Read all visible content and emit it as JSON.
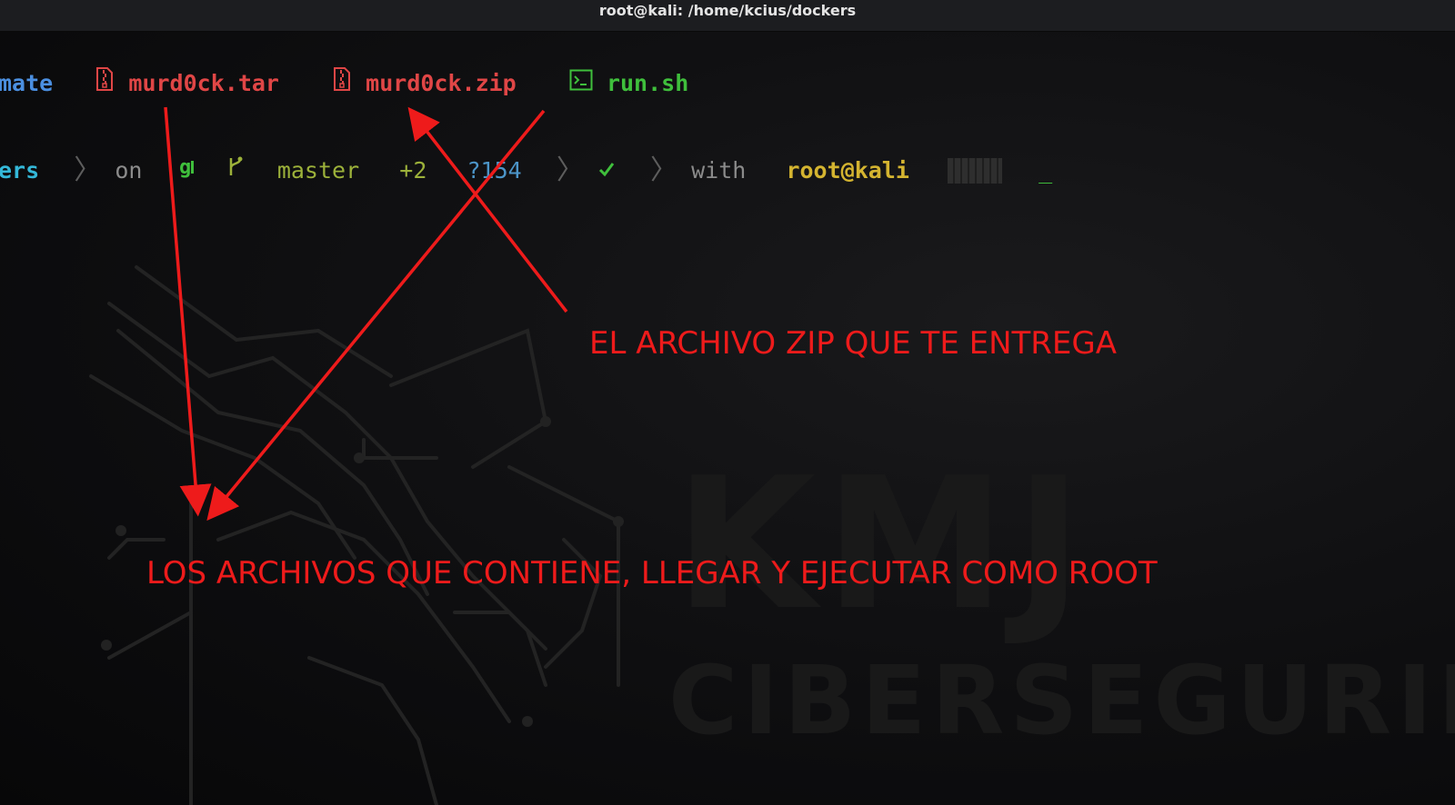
{
  "window": {
    "title": "root@kali: /home/kcius/dockers"
  },
  "wallpaper": {
    "brand_line1": "KMJ",
    "brand_line2": "CIBERSEGURIDA"
  },
  "listing": {
    "items": [
      {
        "name": "mate",
        "icon": "none",
        "color": "#4b8fe0"
      },
      {
        "name": "murd0ck.tar",
        "icon": "archive-icon",
        "color": "#e04646"
      },
      {
        "name": "murd0ck.zip",
        "icon": "archive-icon",
        "color": "#e04646"
      },
      {
        "name": "run.sh",
        "icon": "terminal-icon",
        "color": "#3fbf3c"
      }
    ]
  },
  "prompt": {
    "dir": "ers",
    "on": "on",
    "git_icon": "git-icon",
    "branch_icon": "branch-icon",
    "branch": "master",
    "staged": "+2",
    "untracked": "?154",
    "status_icon": "check-icon",
    "with": "with",
    "user_host": "root@kali",
    "cursor": "_"
  },
  "annotations": {
    "zip_label": "EL ARCHIVO ZIP QUE TE ENTREGA",
    "contents_label": "LOS ARCHIVOS QUE CONTIENE, LLEGAR Y EJECUTAR COMO ROOT",
    "color": "#ee1b1b"
  }
}
